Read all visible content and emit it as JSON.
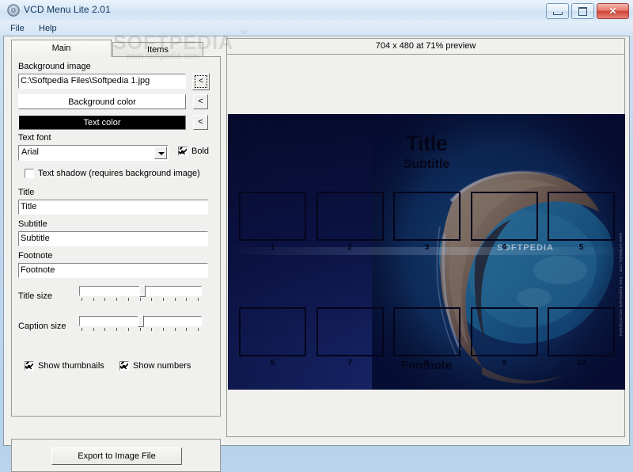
{
  "window": {
    "title": "VCD Menu Lite 2.01",
    "icon": "cd-disc-icon",
    "minimize_label": "Minimize",
    "maximize_label": "Maximize",
    "close_label": "✕"
  },
  "menubar": {
    "items": [
      {
        "label": "File"
      },
      {
        "label": "Help"
      }
    ]
  },
  "tabs": [
    {
      "label": "Main",
      "active": true
    },
    {
      "label": "Items",
      "active": false
    }
  ],
  "form": {
    "background_image_label": "Background image",
    "background_image_value": "C:\\Softpedia Files\\Softpedia 1.jpg",
    "browse_button_label": "<",
    "background_color_label": "Background color",
    "background_color_pick_label": "<",
    "background_color_value": "#ffffff",
    "text_color_label": "Text color",
    "text_color_pick_label": "<",
    "text_color_value": "#000000",
    "text_font_label": "Text font",
    "text_font_value": "Arial",
    "bold_label": "Bold",
    "bold_checked": true,
    "text_shadow_label": "Text shadow (requires background image)",
    "text_shadow_checked": false,
    "title_label": "Title",
    "title_value": "Title",
    "subtitle_label": "Subtitle",
    "subtitle_value": "Subtitle",
    "footnote_label": "Footnote",
    "footnote_value": "Footnote",
    "title_size_label": "Title size",
    "title_size_percent": 52,
    "caption_size_label": "Caption size",
    "caption_size_percent": 50,
    "show_thumbnails_label": "Show thumbnails",
    "show_thumbnails_checked": true,
    "show_numbers_label": "Show numbers",
    "show_numbers_checked": true
  },
  "actions": {
    "export_label": "Export to Image File"
  },
  "preview": {
    "header": "704 x 480 at 71% preview",
    "title": "Title",
    "subtitle": "Subtitle",
    "footnote": "Footnote",
    "thumbnail_numbers": [
      "1",
      "2",
      "3",
      "4",
      "5",
      "6",
      "7",
      "8",
      "9",
      "10"
    ],
    "background_color": "#0a1140",
    "text_color": "#05061a",
    "photo_alt": "aerial-island-atoll-photo"
  },
  "watermark": {
    "brand": "SOFTPEDIA",
    "url": "www.softpedia.com",
    "tm": "TM",
    "preview_brand": "SOFTPEDIA",
    "preview_side": "www.softpedia.com  ·  free downloads encyclopedia"
  }
}
